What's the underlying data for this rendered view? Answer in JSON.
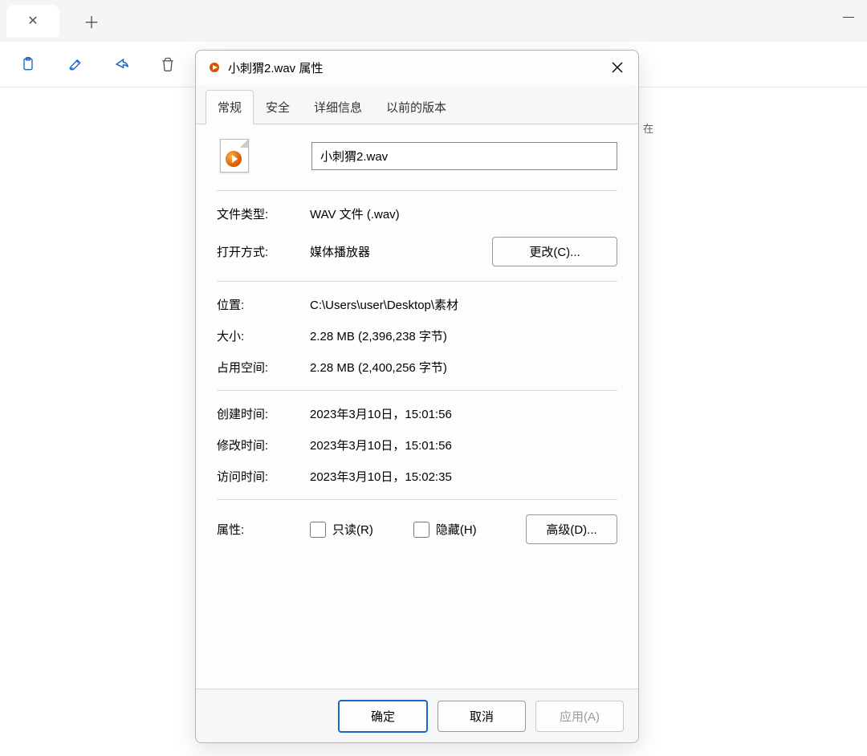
{
  "dialog": {
    "title": "小刺猬2.wav 属性",
    "tabs": [
      "常规",
      "安全",
      "详细信息",
      "以前的版本"
    ],
    "filename_value": "小刺猬2.wav",
    "rows": {
      "file_type_label": "文件类型:",
      "file_type_value": "WAV 文件 (.wav)",
      "open_with_label": "打开方式:",
      "open_with_value": "媒体播放器",
      "change_button": "更改(C)...",
      "location_label": "位置:",
      "location_value": "C:\\Users\\user\\Desktop\\素材",
      "size_label": "大小:",
      "size_value": "2.28 MB (2,396,238 字节)",
      "size_on_disk_label": "占用空间:",
      "size_on_disk_value": "2.28 MB (2,400,256 字节)",
      "created_label": "创建时间:",
      "created_value": "2023年3月10日，15:01:56",
      "modified_label": "修改时间:",
      "modified_value": "2023年3月10日，15:01:56",
      "accessed_label": "访问时间:",
      "accessed_value": "2023年3月10日，15:02:35",
      "attributes_label": "属性:",
      "readonly_label": "只读(R)",
      "hidden_label": "隐藏(H)",
      "advanced_button": "高级(D)..."
    },
    "footer": {
      "ok": "确定",
      "cancel": "取消",
      "apply": "应用(A)"
    }
  },
  "bg": {
    "right_text": "在"
  }
}
